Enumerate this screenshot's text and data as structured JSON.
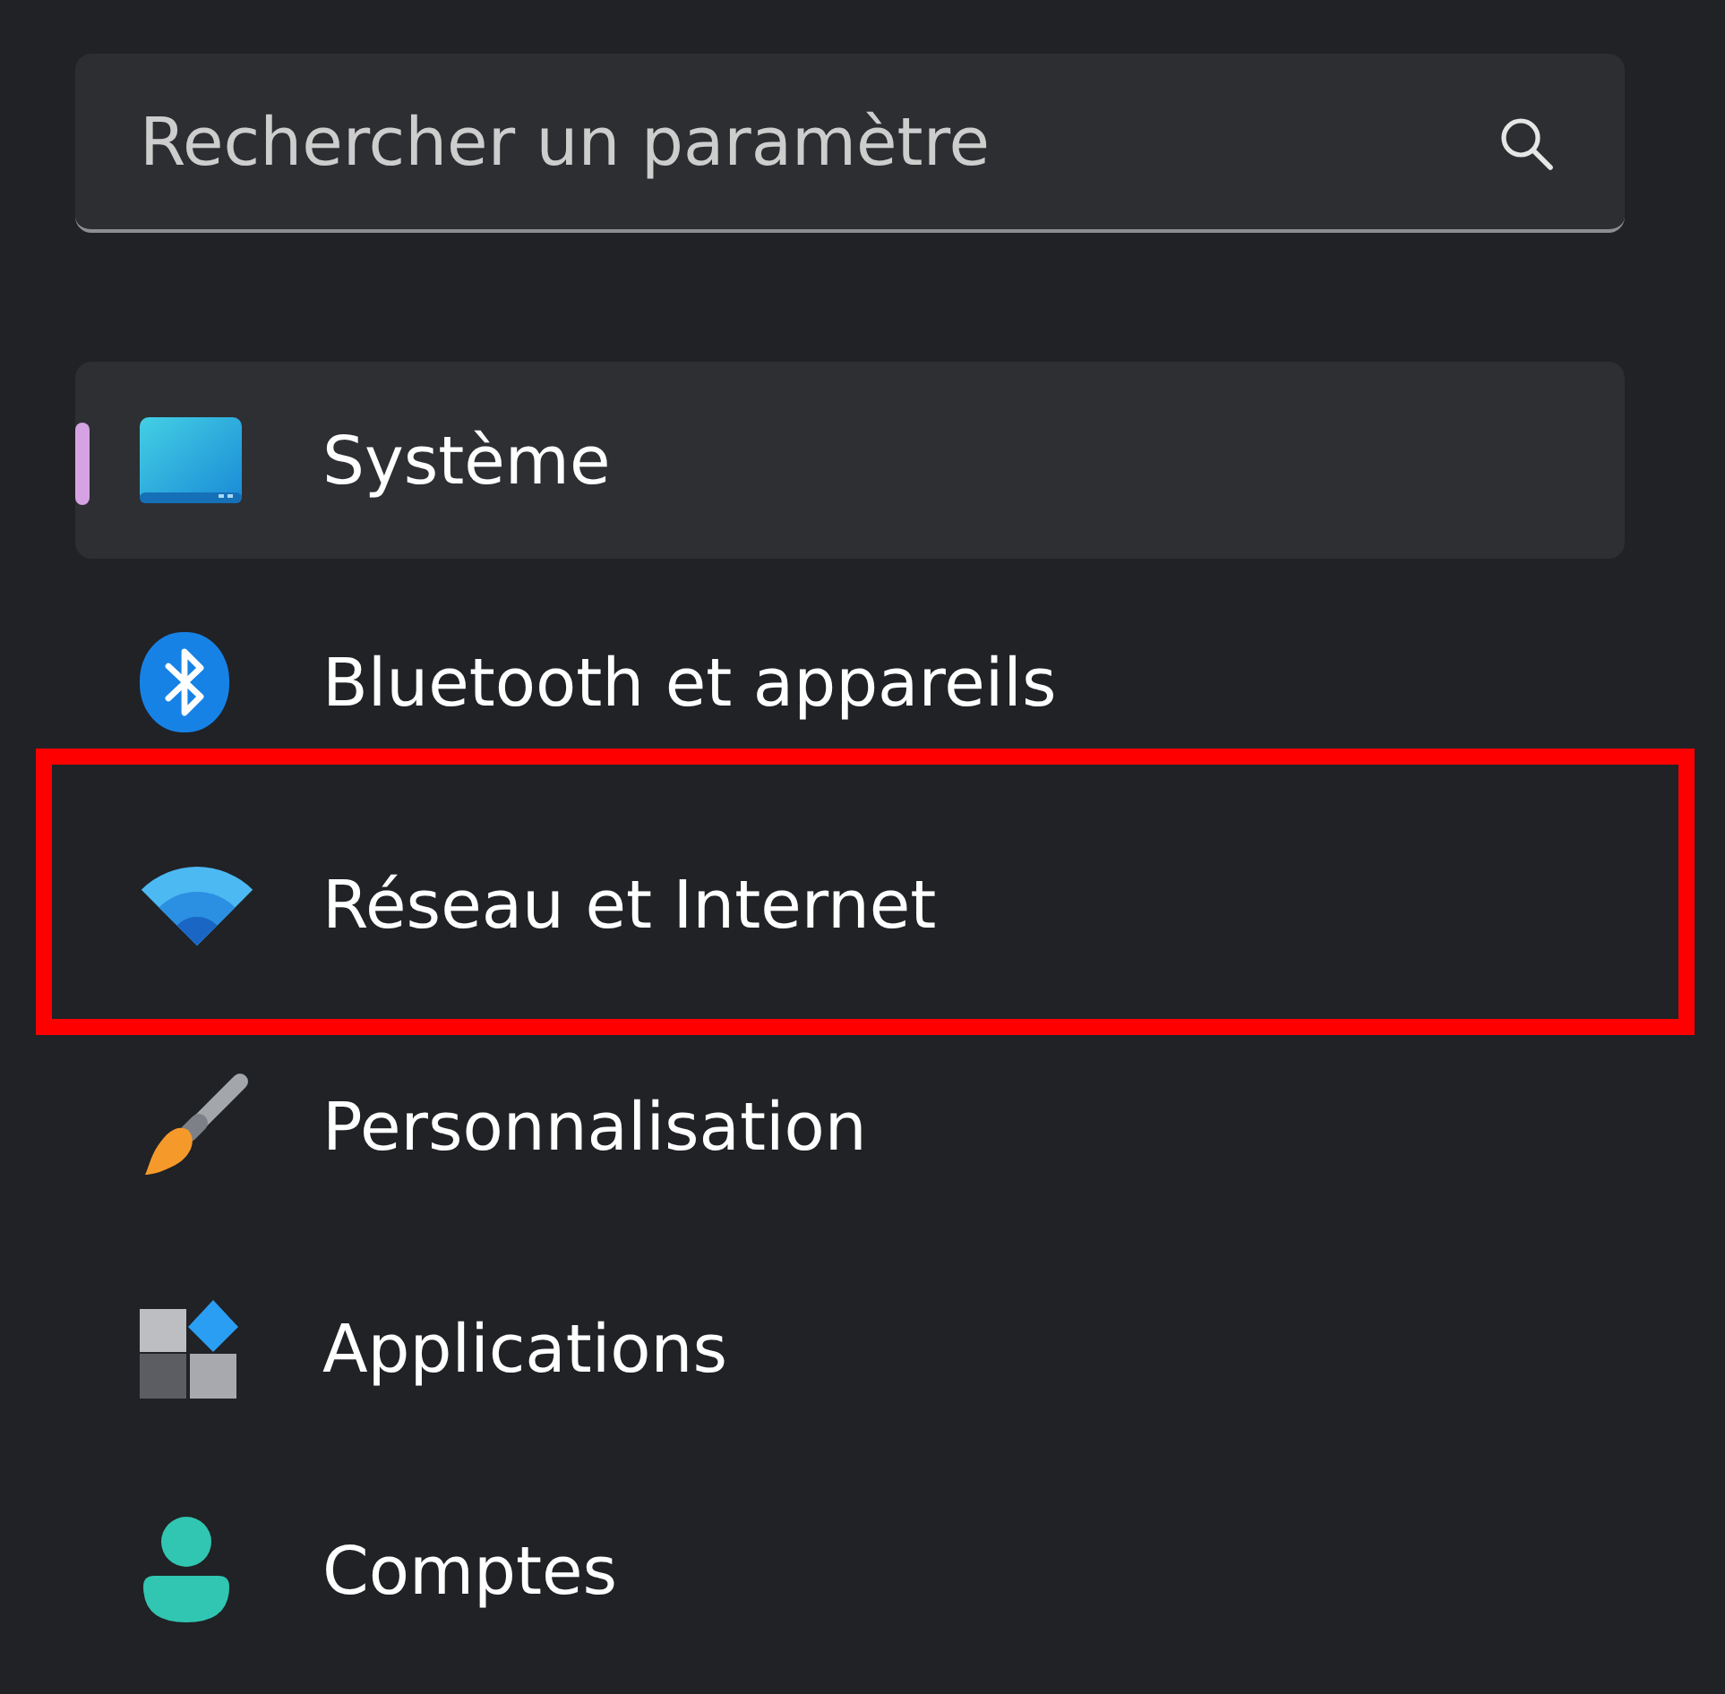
{
  "search": {
    "placeholder": "Rechercher un paramètre"
  },
  "nav_items": [
    {
      "label": "Système",
      "selected": true,
      "highlighted": false
    },
    {
      "label": "Bluetooth et appareils",
      "selected": false,
      "highlighted": false
    },
    {
      "label": "Réseau et Internet",
      "selected": false,
      "highlighted": true
    },
    {
      "label": "Personnalisation",
      "selected": false,
      "highlighted": false
    },
    {
      "label": "Applications",
      "selected": false,
      "highlighted": false
    },
    {
      "label": "Comptes",
      "selected": false,
      "highlighted": false
    }
  ]
}
